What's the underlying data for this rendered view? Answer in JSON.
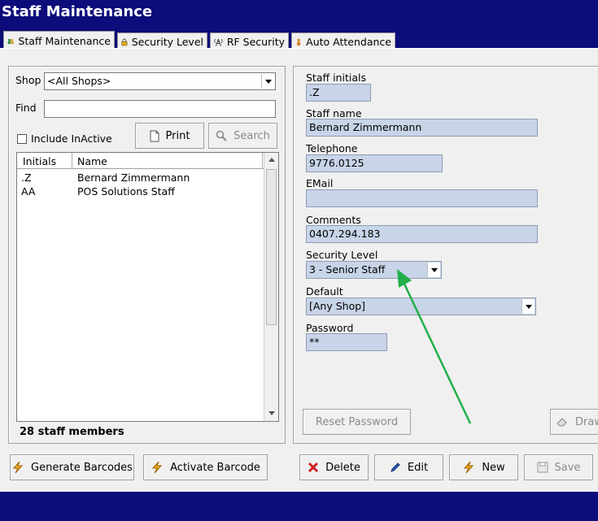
{
  "window": {
    "title": "Staff Maintenance"
  },
  "tabs": [
    {
      "label": "Staff Maintenance",
      "mnemonic": "M",
      "icon": "people-icon"
    },
    {
      "label": "Security Level",
      "mnemonic": "L",
      "icon": "lock-icon"
    },
    {
      "label": "RF Security",
      "mnemonic": "R",
      "icon": "antenna-icon"
    },
    {
      "label": "Auto Attendance",
      "mnemonic": "A",
      "icon": "person-icon"
    }
  ],
  "filter": {
    "shop_label": "Shop",
    "shop_value": "<All Shops>",
    "find_label": "Find",
    "find_value": "",
    "include_inactive_label": "Include InActive",
    "include_inactive_checked": false,
    "print_label": "Print",
    "search_label": "Search"
  },
  "staff_list": {
    "columns": [
      "Initials",
      "Name"
    ],
    "rows": [
      {
        "initials": ".Z",
        "name": "Bernard Zimmermann"
      },
      {
        "initials": "AA",
        "name": "POS Solutions Staff"
      }
    ],
    "count_text": "28 staff members"
  },
  "details": {
    "initials_label": "Staff initials",
    "initials_value": ".Z",
    "name_label": "Staff name",
    "name_value": "Bernard Zimmermann",
    "telephone_label": "Telephone",
    "telephone_value": "9776.0125",
    "email_label": "EMail",
    "email_value": "",
    "comments_label": "Comments",
    "comments_value": "0407.294.183",
    "security_label": "Security Level",
    "security_value": "3 -  Senior Staff",
    "default_label": "Default",
    "default_value": "[Any Shop]",
    "password_label": "Password",
    "password_value": "**",
    "reset_password_label": "Reset Password",
    "draw_label": "Draw"
  },
  "actions": {
    "generate_barcodes": "Generate Barcodes",
    "activate_barcode": "Activate Barcode",
    "delete": "Delete",
    "edit": "Edit",
    "new": "New",
    "save": "Save"
  },
  "annotation": {
    "arrow_color": "#22b04a"
  }
}
